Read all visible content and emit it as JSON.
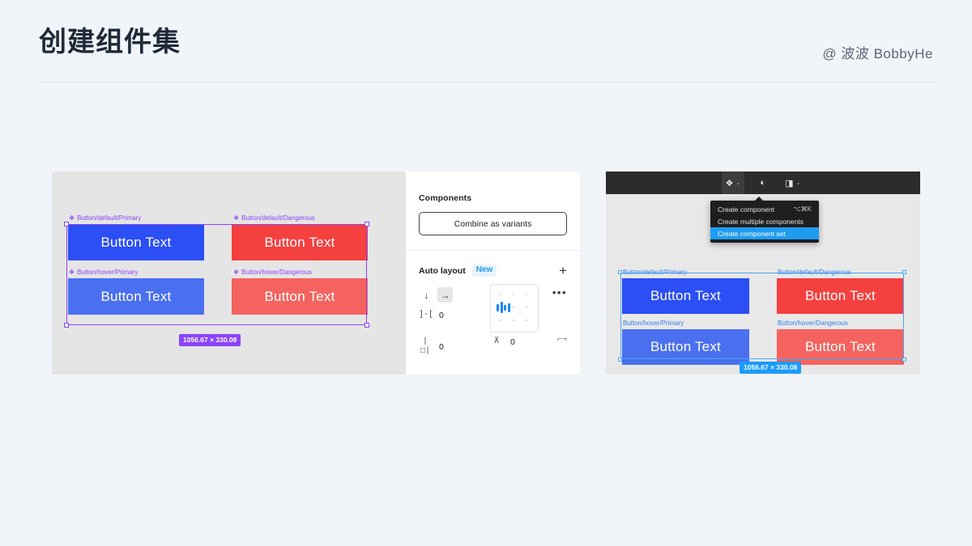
{
  "header": {
    "title": "创建组件集",
    "attribution": "@ 波波 BobbyHe"
  },
  "left_figma": {
    "components": [
      {
        "label": "Button/default/Primary",
        "text": "Button Text",
        "variant": "blue"
      },
      {
        "label": "Button/default/Dangerous",
        "text": "Button Text",
        "variant": "red"
      },
      {
        "label": "Button/hover/Primary",
        "text": "Button Text",
        "variant": "blue-hov"
      },
      {
        "label": "Button/hover/Dangerous",
        "text": "Button Text",
        "variant": "red-hov"
      }
    ],
    "size_badge": "1056.67 × 330.08",
    "selection_color": "#8b43f7"
  },
  "right_panel": {
    "components_section": {
      "title": "Components",
      "combine_button": "Combine as variants"
    },
    "auto_layout_section": {
      "title": "Auto layout",
      "new_badge": "New",
      "add_button": "+",
      "direction_vertical": "↓",
      "direction_horizontal": "→",
      "gap_icon": "]·[",
      "gap_value": "0",
      "padding_h_icon": "|□|",
      "padding_h_value": "0",
      "padding_v_icon": "⊼",
      "padding_v_value": "0",
      "more_button": "•••",
      "clip_icon": "⌐¬",
      "accent_color": "#1f9cf0"
    }
  },
  "right_figma": {
    "toolbar": {
      "component_icon": "❖",
      "mask_icon": "◐",
      "boolean_icon": "◨",
      "caret": "⌄"
    },
    "context_menu": {
      "items": [
        {
          "label": "Create component",
          "shortcut": "⌥⌘K",
          "selected": false
        },
        {
          "label": "Create multiple components",
          "shortcut": "",
          "selected": false
        },
        {
          "label": "Create component set",
          "shortcut": "",
          "selected": true
        }
      ],
      "highlight_color": "#1f9cf0"
    },
    "components": [
      {
        "label": "Button/default/Primary",
        "text": "Button Text",
        "variant": "blue"
      },
      {
        "label": "Button/default/Dangerous",
        "text": "Button Text",
        "variant": "red"
      },
      {
        "label": "Button/hover/Primary",
        "text": "Button Text",
        "variant": "blue-hov"
      },
      {
        "label": "Button/hover/Dangerous",
        "text": "Button Text",
        "variant": "red-hov"
      }
    ],
    "size_badge": "1056.67 × 330.08",
    "selection_color": "#4aa5f5"
  }
}
